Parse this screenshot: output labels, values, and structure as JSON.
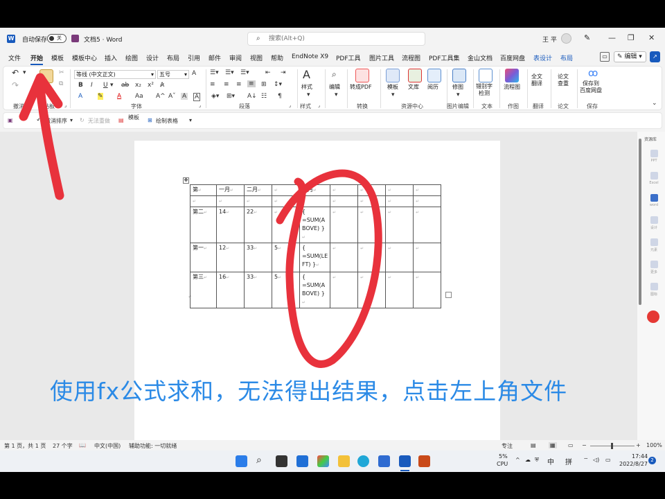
{
  "title_bar": {
    "autosave_label": "自动保存",
    "autosave_state": "关",
    "doc_name": "文档5",
    "app_name": "Word",
    "search_placeholder": "搜索(Alt+Q)",
    "user_name": "王 平"
  },
  "tabs": [
    "文件",
    "开始",
    "模板",
    "模板中心",
    "插入",
    "绘图",
    "设计",
    "布局",
    "引用",
    "邮件",
    "审阅",
    "视图",
    "帮助",
    "EndNote X9",
    "PDF工具",
    "图片工具",
    "流程图",
    "PDF工具集",
    "金山文档",
    "百度网盘",
    "表设计",
    "布局"
  ],
  "tab_right": {
    "edit_label": "编辑"
  },
  "ribbon": {
    "font_name": "等线 (中文正文)",
    "font_size": "五号",
    "groups": [
      "撤消",
      "剪贴板",
      "字体",
      "段落",
      "样式",
      "转换",
      "资源中心",
      "图片编辑",
      "文本",
      "作图",
      "翻译",
      "论文",
      "保存"
    ],
    "buttons": {
      "styles": "样式",
      "editing": "编辑",
      "to_pdf": "转成PDF",
      "template": "模板",
      "library": "文库",
      "reading": "阅历",
      "picture": "修图",
      "typo_check": "错别字\n检测",
      "flowchart": "流程图",
      "translate": "全文\n翻译",
      "paper_check": "论文\n查重",
      "save_cloud": "保存到\n百度网盘"
    }
  },
  "qat": {
    "undo_sort": "撤消排序",
    "redo": "无法重做",
    "template": "模板",
    "draw_table": "绘制表格"
  },
  "table": {
    "rows": [
      [
        "第",
        "一月",
        "二月",
        "",
        "四月",
        "",
        "",
        "",
        ""
      ],
      [
        "",
        "",
        "",
        "",
        "",
        "",
        "",
        "",
        ""
      ],
      [
        "第二",
        "14",
        "22",
        "",
        "{\n=SUM(A\nBOVE) }",
        "",
        "",
        "",
        ""
      ],
      [
        "第一",
        "12",
        "33",
        "5",
        "{\n=SUM(LE\nFT) }",
        "",
        "",
        "",
        ""
      ],
      [
        "第三",
        "16",
        "33",
        "5",
        "{\n=SUM(A\nBOVE) }",
        "",
        "",
        "",
        ""
      ]
    ]
  },
  "right_pane": {
    "title": "资源库",
    "items": [
      "PPT",
      "Excel",
      "word",
      "设计",
      "元素",
      "更多",
      "图标"
    ]
  },
  "status": {
    "page": "第 1 页，共 1 页",
    "words": "27 个字",
    "language": "中文(中国)",
    "accessibility": "辅助功能: 一切就绪",
    "focus": "专注",
    "zoom": "100%"
  },
  "taskbar": {
    "cpu": "5%",
    "cpu_label": "CPU",
    "ime_lang": "中",
    "ime_mode": "拼",
    "time": "17:44",
    "date": "2022/8/27",
    "notifications": "2"
  },
  "annotation": {
    "caption": "使用fx公式求和，无法得出结果，点击左上角文件",
    "color": "#e8323c"
  }
}
